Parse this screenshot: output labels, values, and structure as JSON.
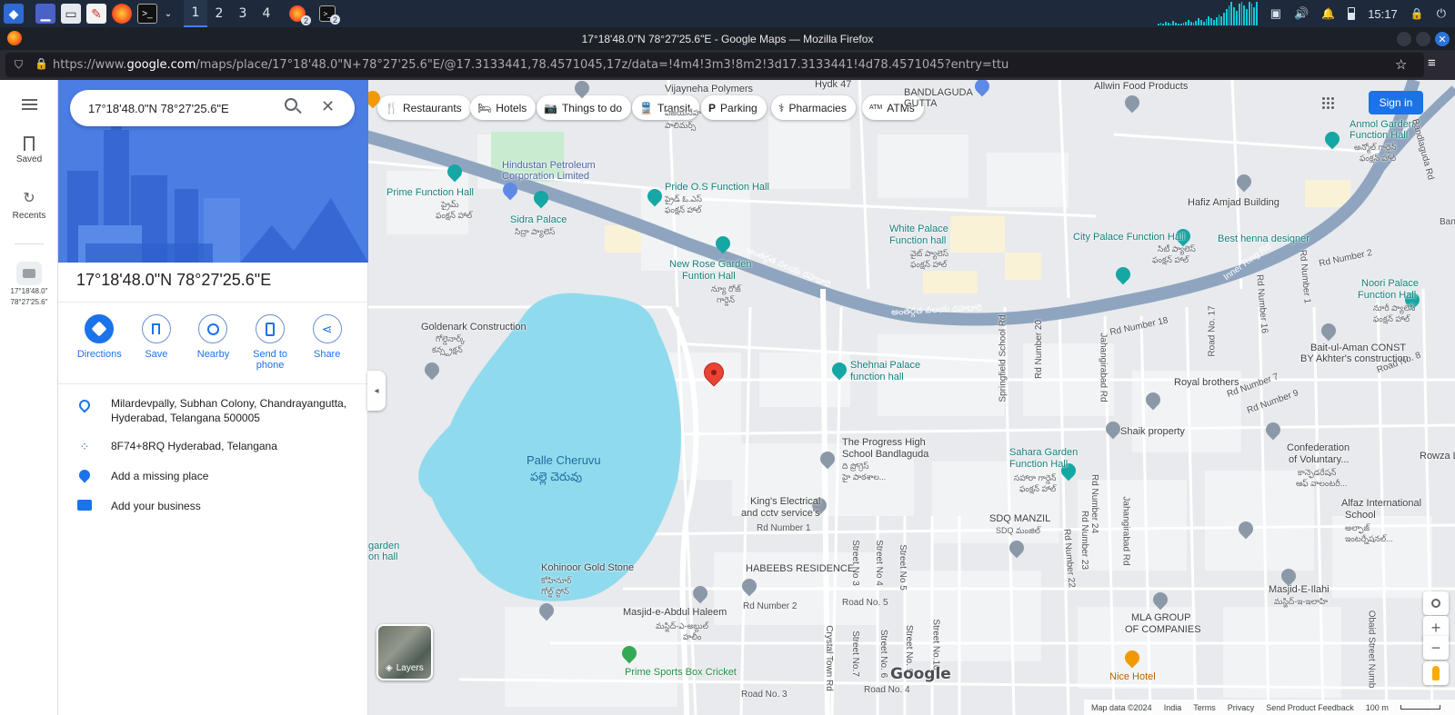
{
  "taskbar": {
    "workspaces": [
      "1",
      "2",
      "3",
      "4"
    ],
    "active_workspace": "1",
    "badge_firefox": "2",
    "badge_terminal": "2",
    "clock": "15:17"
  },
  "window": {
    "title": "17°18'48.0\"N 78°27'25.6\"E - Google Maps — Mozilla Firefox"
  },
  "urlbar": {
    "prefix": "https://www.",
    "domain": "google.com",
    "path": "/maps/place/17°18'48.0\"N+78°27'25.6\"E/@17.3133441,78.4571045,17z/data=!4m4!3m3!8m2!3d17.3133441!4d78.4571045?entry=ttu"
  },
  "rail": {
    "saved_label": "Saved",
    "recents_label": "Recents",
    "recent_item_line1": "17°18'48.0\"",
    "recent_item_line2": "78°27'25.6\""
  },
  "panel": {
    "search_value": "17°18'48.0\"N 78°27'25.6\"E",
    "title": "17°18'48.0\"N 78°27'25.6\"E",
    "actions": [
      {
        "label": "Directions"
      },
      {
        "label": "Save"
      },
      {
        "label": "Nearby"
      },
      {
        "label": "Send to phone"
      },
      {
        "label": "Share"
      }
    ],
    "address_line1": "Milardevpally, Subhan Colony, Chandrayangutta,",
    "address_line2": "Hyderabad, Telangana 500005",
    "plus_code": "8F74+8RQ Hyderabad, Telangana",
    "add_missing_place": "Add a missing place",
    "add_business": "Add your business"
  },
  "map": {
    "chips": [
      "Restaurants",
      "Hotels",
      "Things to do",
      "Transit",
      "Parking",
      "Pharmacies",
      "ATMs"
    ],
    "sign_in": "Sign in",
    "layers_label": "Layers",
    "google_logo": "Google",
    "footer": [
      "Map data ©2024",
      "India",
      "Terms",
      "Privacy",
      "Send Product Feedback",
      "100 m"
    ],
    "labels": {
      "vijayneha": "Vijayneha Polymers",
      "vijayneha_te": "విజయనేహ",
      "vijayneha_te2": "పాలిమర్స్",
      "hydk": "Hydk 47",
      "bandlaguda": "BANDLAGUDA",
      "gutta": "GUTTA",
      "allwin": "Allwin Food Products",
      "hindustan1": "Hindustan Petroleum",
      "hindustan2": "Corporation Limited",
      "prime_fh": "Prime Function Hall",
      "prime_te": "ప్రైమ్",
      "prime_te2": "ఫంక్షన్ హాల్",
      "sidra": "Sidra Palace",
      "sidra_te": "సిద్రా ప్యాలెస్",
      "pride": "Pride O.S Function Hall",
      "pride_te": "ప్రైడ్ ఓ.ఎస్",
      "pride_te2": "ఫంక్షన్ హాల్",
      "anmol1": "Anmol Garden",
      "anmol2": "Function Hall",
      "anmol_te": "అన్మోల్ గార్డెన్",
      "anmol_te2": "ఫంక్షన్ హాల్",
      "hafiz": "Hafiz Amjad Building",
      "white1": "White Palace",
      "white2": "Function hall",
      "white_te": "వైట్ ప్యాలెస్",
      "white_te2": "ఫంక్షన్ హాల్",
      "city_palace": "City Palace Function Hall",
      "city_te": "సిటీ ప్యాలెస్",
      "city_te2": "ఫంక్షన్ హాల్",
      "henna": "Best henna designer",
      "newrose1": "New Rose Garden",
      "newrose2": "Funtion Hall",
      "newrose_te": "న్యూ రోజ్",
      "newrose_te2": "గార్డెన్",
      "ring_road_te": "అంతర్గత వలయ రహదారి",
      "ring_road_te2": "అంతర్గత వలయ రహదారి",
      "inner_ring": "Inner Ring Rd",
      "bandlaguda_rd": "Bandlaguda Rd",
      "goldenark": "Goldenark Construction",
      "goldenark_te": "గోల్డెనార్క్",
      "goldenark_te2": "కన్స్ట్రక్షన్",
      "shehnai1": "Shehnai Palace",
      "shehnai2": "function hall",
      "noori1": "Noori Palace",
      "noori2": "Function Hall",
      "noori_te": "నూరీ ప్యాలెస్",
      "noori_te2": "ఫంక్షన్ హాల్",
      "rd18": "Rd Number 18",
      "rd2": "Rd Number 2",
      "rd8": "Road No. 8",
      "rd7": "Rd Number 7",
      "rd9": "Rd Number 9",
      "baitul1": "Bait-ul-Aman CONST",
      "baitul2": "BY Akhter's construction",
      "royal": "Royal brothers",
      "shaik": "Shaik property",
      "lake1": "Palle Cheruvu",
      "lake2": "పల్లె చెరువు",
      "progress1": "The Progress High",
      "progress2": "School Bandlaguda",
      "progress_te": "ది ప్రోగ్రెస్",
      "progress_te2": "హై పాఠశాల...",
      "sahara1": "Sahara Garden",
      "sahara2": "Function Hall",
      "sahara_te": "సహారా గార్డెన్",
      "sahara_te2": "ఫంక్షన్ హాల్",
      "confed1": "Confederation",
      "confed2": "of Voluntary...",
      "confed_te": "కాన్ఫెడరేషన్",
      "confed_te2": "ఆఫ్ వాలంటరీ...",
      "kings1": "King's Electrical",
      "kings2": "and cctv service's",
      "rd1": "Rd Number 1",
      "sdq": "SDQ MANZIL",
      "sdq_te": "SDQ మంజిల్",
      "alfaz1": "Alfaz International",
      "alfaz2": "School",
      "alfaz_te": "అల్ఫాజ్",
      "alfaz_te2": "ఇంటర్నేషనల్...",
      "garden1": "garden",
      "garden2": "on hall",
      "kohinoor": "Kohinoor Gold Stone",
      "kohinoor_te": "కోహినూర్",
      "kohinoor_te2": "గోల్డ్ స్టోన్",
      "habeebs": "HABEEBS RESIDENCE",
      "masjid_ilahi": "Masjid-E-Ilahi",
      "masjid_ilahi_te": "మస్జిద్-ఇ-ఇలాహి",
      "masjid_haleem": "Masjid-e-Abdul Haleem",
      "masjid_haleem_te": "మస్జిద్-ఎ-అబ్దుల్",
      "masjid_haleem_te2": "హలీం",
      "rd2b": "Rd Number 2",
      "road5": "Road No. 5",
      "mla1": "MLA GROUP",
      "mla2": "OF COMPANIES",
      "prime_sports": "Prime Sports Box Cricket",
      "nice_hotel": "Nice Hotel",
      "road3": "Road No. 3",
      "road4": "Road No. 4",
      "rowza": "Rowza L",
      "springfield": "Springfield School Rd",
      "rdno20": "Rd Number 20",
      "jahangirabad": "Jahangirabad Rd",
      "jahangirabad2": "Jahangirabad Rd",
      "rdno17": "Road No. 17",
      "rdno16": "Rd Number 16",
      "rdno1": "Rd Number 1",
      "rd24": "Rd Number 24",
      "rd23": "Rd Number 23",
      "rd22": "Rd Number 22",
      "st3": "Street No 3",
      "st4": "Street No 4",
      "st5": "Street No 5",
      "st7": "Street No.7",
      "st6": "Street No. 6",
      "st9": "Street No. 9",
      "st10": "Street No.10",
      "crystal": "Crystal Town Rd",
      "obaid": "Obaid Street Numb",
      "ban": "Ban"
    }
  },
  "colors": {
    "accent": "#1a73e8",
    "water": "#90daee",
    "major_road": "#8fa5bf",
    "pin": "#ea4335"
  }
}
